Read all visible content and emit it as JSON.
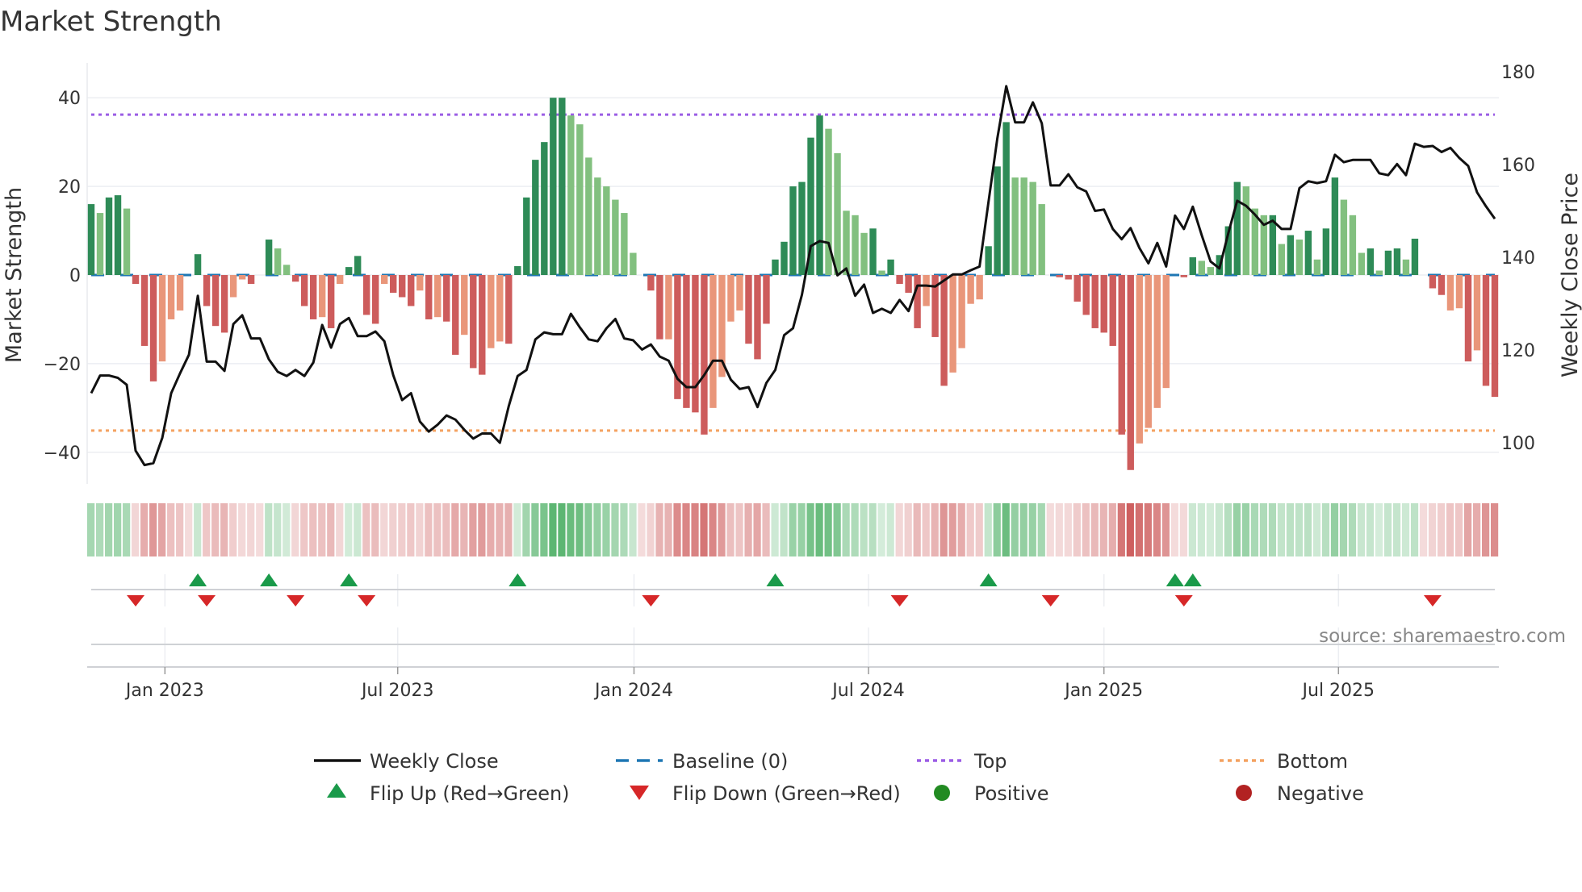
{
  "chart_data": {
    "type": "bar",
    "title": "Market Strength",
    "ylabel": "Market Strength",
    "y2label": "Weekly Close Price",
    "ylim": [
      -47,
      47
    ],
    "y2lim": [
      90,
      184
    ],
    "yticks": [
      -40,
      -20,
      0,
      20,
      40
    ],
    "ytick_labels": [
      "−40",
      "−20",
      "0",
      "20",
      "40"
    ],
    "y2ticks": [
      100,
      120,
      140,
      160,
      180
    ],
    "y2tick_labels": [
      "100",
      "120",
      "140",
      "160",
      "180"
    ],
    "xticks": [
      {
        "label": "Jan 2023",
        "week_index": 8.3
      },
      {
        "label": "Jul 2023",
        "week_index": 34.5
      },
      {
        "label": "Jan 2024",
        "week_index": 61.1
      },
      {
        "label": "Jul 2024",
        "week_index": 87.5
      },
      {
        "label": "Jan 2025",
        "week_index": 114.0
      },
      {
        "label": "Jul 2025",
        "week_index": 140.4
      }
    ],
    "top_level": 36.2,
    "bottom_level": -35.1,
    "baseline": 0,
    "strength": [
      16,
      14,
      17.5,
      18,
      15,
      -2,
      -16,
      -24,
      -19.5,
      -10,
      -8,
      0,
      4.7,
      -7,
      -11.5,
      -13,
      -5,
      -1,
      -2,
      0,
      8,
      6,
      2.3,
      -1.5,
      -7,
      -10,
      -9.5,
      -12,
      -2,
      1.8,
      4.3,
      -9,
      -11,
      -2,
      -4,
      -5,
      -7,
      -3.5,
      -10,
      -9.5,
      -10.5,
      -18,
      -13.5,
      -21,
      -22.5,
      -16.5,
      -15,
      -15.5,
      2,
      17.5,
      26,
      30,
      40,
      40,
      36,
      34,
      26.5,
      22,
      20,
      17,
      14,
      5,
      0,
      -3.5,
      -14.5,
      -14.5,
      -28,
      -30,
      -31,
      -36,
      -30,
      -23,
      -10.5,
      -8,
      -15.5,
      -19,
      -11,
      3.5,
      7.5,
      20,
      21,
      31,
      36,
      33,
      27.5,
      14.5,
      13.5,
      9.5,
      10.5,
      1,
      3.5,
      -2,
      -4,
      -12,
      -7,
      -14,
      -25,
      -22,
      -16.5,
      -6.5,
      -5.5,
      6.5,
      24.5,
      34.5,
      22,
      22,
      21,
      16,
      0,
      -0.5,
      -1,
      -6,
      -9,
      -12,
      -13,
      -16,
      -36,
      -44,
      -38,
      -34.5,
      -30,
      -25.5,
      0,
      -0.5,
      4,
      3.2,
      1.8,
      4.5,
      11,
      21,
      20,
      15,
      13.5,
      13.5,
      7,
      9,
      8,
      10,
      3.5,
      10.5,
      22,
      17,
      13.5,
      5,
      6,
      1,
      5.5,
      6,
      3.5,
      8.2,
      0,
      -3,
      -4.5,
      -8,
      -7.5,
      -19.5,
      -17,
      -25,
      -27.5
    ],
    "shade": "DLDDLDDDLLL-DDDDLLD-DLLDDDLDLDDDDLDDDLDLDDLDDLLDDDDDDDLLLLLLLL-DDLDDDDLLLLDDDDDDDDDLLLLLDLDDDDLDDLLLLDDDLLLL-DDDDDDDDDLLLL-DDLLDDDLLLDLDLDLDDLLLDLDDLD-DDLLDLDD",
    "weekly_close": [
      110.7,
      114.5,
      114.5,
      114,
      112.5,
      98.3,
      95.2,
      95.6,
      101.1,
      110.7,
      115,
      119,
      131.7,
      117.5,
      117.5,
      115.5,
      125.6,
      127.5,
      122.5,
      122.5,
      118,
      115.3,
      114.4,
      115.7,
      114.4,
      117.3,
      125.4,
      120.5,
      125.6,
      126.9,
      123,
      123,
      124,
      121.9,
      114.6,
      109.2,
      110.7,
      104.6,
      102.4,
      103.9,
      105.9,
      105,
      102.8,
      100.9,
      102,
      102,
      100,
      107.9,
      114.4,
      115.7,
      122.3,
      123.8,
      123.4,
      123.4,
      127.8,
      124.9,
      122.3,
      121.9,
      124.7,
      126.7,
      122.5,
      122.1,
      120.1,
      121.2,
      118.6,
      117.7,
      113.8,
      112,
      112,
      114.6,
      117.7,
      117.7,
      113.6,
      111.6,
      112,
      107.7,
      112.9,
      115.7,
      123.2,
      124.7,
      131.9,
      142.4,
      143.5,
      143.1,
      136.1,
      137.6,
      131.7,
      134.1,
      128,
      128.9,
      128,
      130.8,
      128.4,
      133.9,
      133.9,
      133.7,
      135,
      136.3,
      136.3,
      137.2,
      138,
      151.8,
      165.6,
      176.9,
      169.1,
      169.1,
      173.4,
      168.9,
      155.5,
      155.5,
      157.9,
      155.1,
      154.2,
      150,
      150.3,
      146.1,
      143.9,
      146.3,
      142,
      138.7,
      143.1,
      138,
      149,
      146.1,
      150.9,
      144.8,
      139.1,
      137.6,
      145.2,
      152.2,
      151.1,
      149.2,
      147,
      147.9,
      146.1,
      146.1,
      154.9,
      156.4,
      156,
      156.4,
      162.1,
      160.5,
      161,
      161,
      161,
      158.1,
      157.7,
      160.1,
      157.7,
      164.5,
      163.8,
      164,
      162.7,
      163.6,
      161.4,
      159.7,
      154,
      151,
      148.3
    ],
    "flip_up_weeks": [
      12,
      20,
      29,
      48,
      77,
      101,
      122,
      124
    ],
    "flip_down_weeks": [
      5,
      13,
      23,
      31,
      63,
      91,
      108,
      123,
      151
    ],
    "legend": {
      "weekly_close": "Weekly Close",
      "baseline": "Baseline (0)",
      "top": "Top",
      "bottom": "Bottom",
      "flip_up": "Flip Up (Red→Green)",
      "flip_down": "Flip Down (Green→Red)",
      "positive": "Positive",
      "negative": "Negative"
    },
    "legend_position": "bottom",
    "grid": true,
    "source": "source: sharemaestro.com"
  },
  "colors": {
    "green_dark": "#2e8b57",
    "green_light": "#82c07f",
    "red_dark": "#cd5c5c",
    "red_light": "#e9967a",
    "baseline": "#1f77b4",
    "top": "#9b5de5",
    "bottom": "#f4a261",
    "flip_up": "#1a9a4a",
    "flip_down": "#d62728",
    "positive": "#228b22",
    "negative": "#b22222",
    "line": "#111111"
  }
}
